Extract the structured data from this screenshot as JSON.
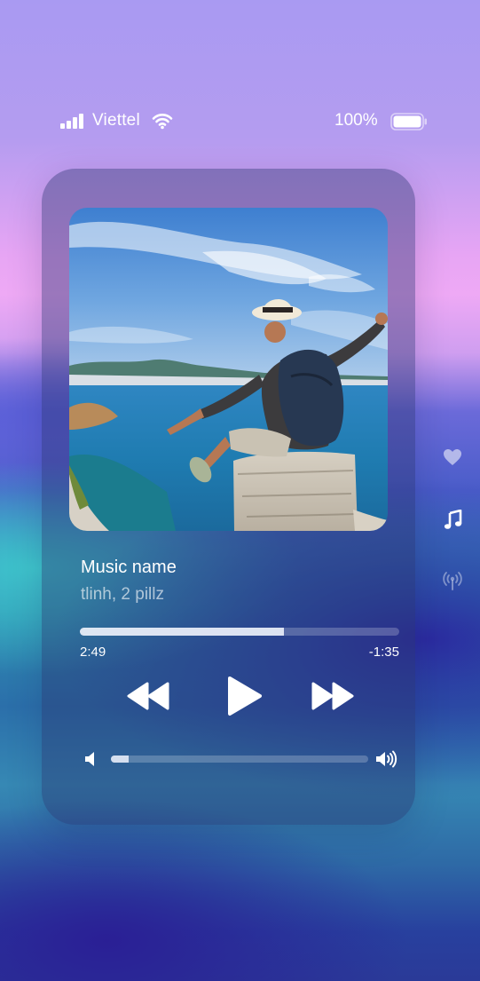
{
  "status_bar": {
    "carrier": "Viettel",
    "battery_text": "100%",
    "signal_icon": "cellular-signal-icon",
    "wifi_icon": "wifi-icon",
    "battery_icon": "battery-icon"
  },
  "player": {
    "title": "Music name",
    "artist": "tlinh, 2 pillz",
    "elapsed": "2:49",
    "remaining": "-1:35",
    "progress_fraction": 0.64,
    "volume_fraction": 0.07,
    "controls": {
      "previous_icon": "rewind-icon",
      "play_icon": "play-icon",
      "next_icon": "fast-forward-icon",
      "volume_low_icon": "volume-low-icon",
      "volume_high_icon": "volume-high-icon"
    }
  },
  "side_menu": {
    "items": [
      "heart-icon",
      "music-note-icon",
      "broadcast-icon"
    ],
    "active": "music-note-icon"
  },
  "colors": {
    "text": "#ffffff",
    "card": "rgba(40,50,110,0.42)",
    "bg_top": "#a99af2",
    "bg_pink": "#eea9f5",
    "bg_cyan": "#3ec5cc",
    "bg_blue": "#2a3a98"
  }
}
